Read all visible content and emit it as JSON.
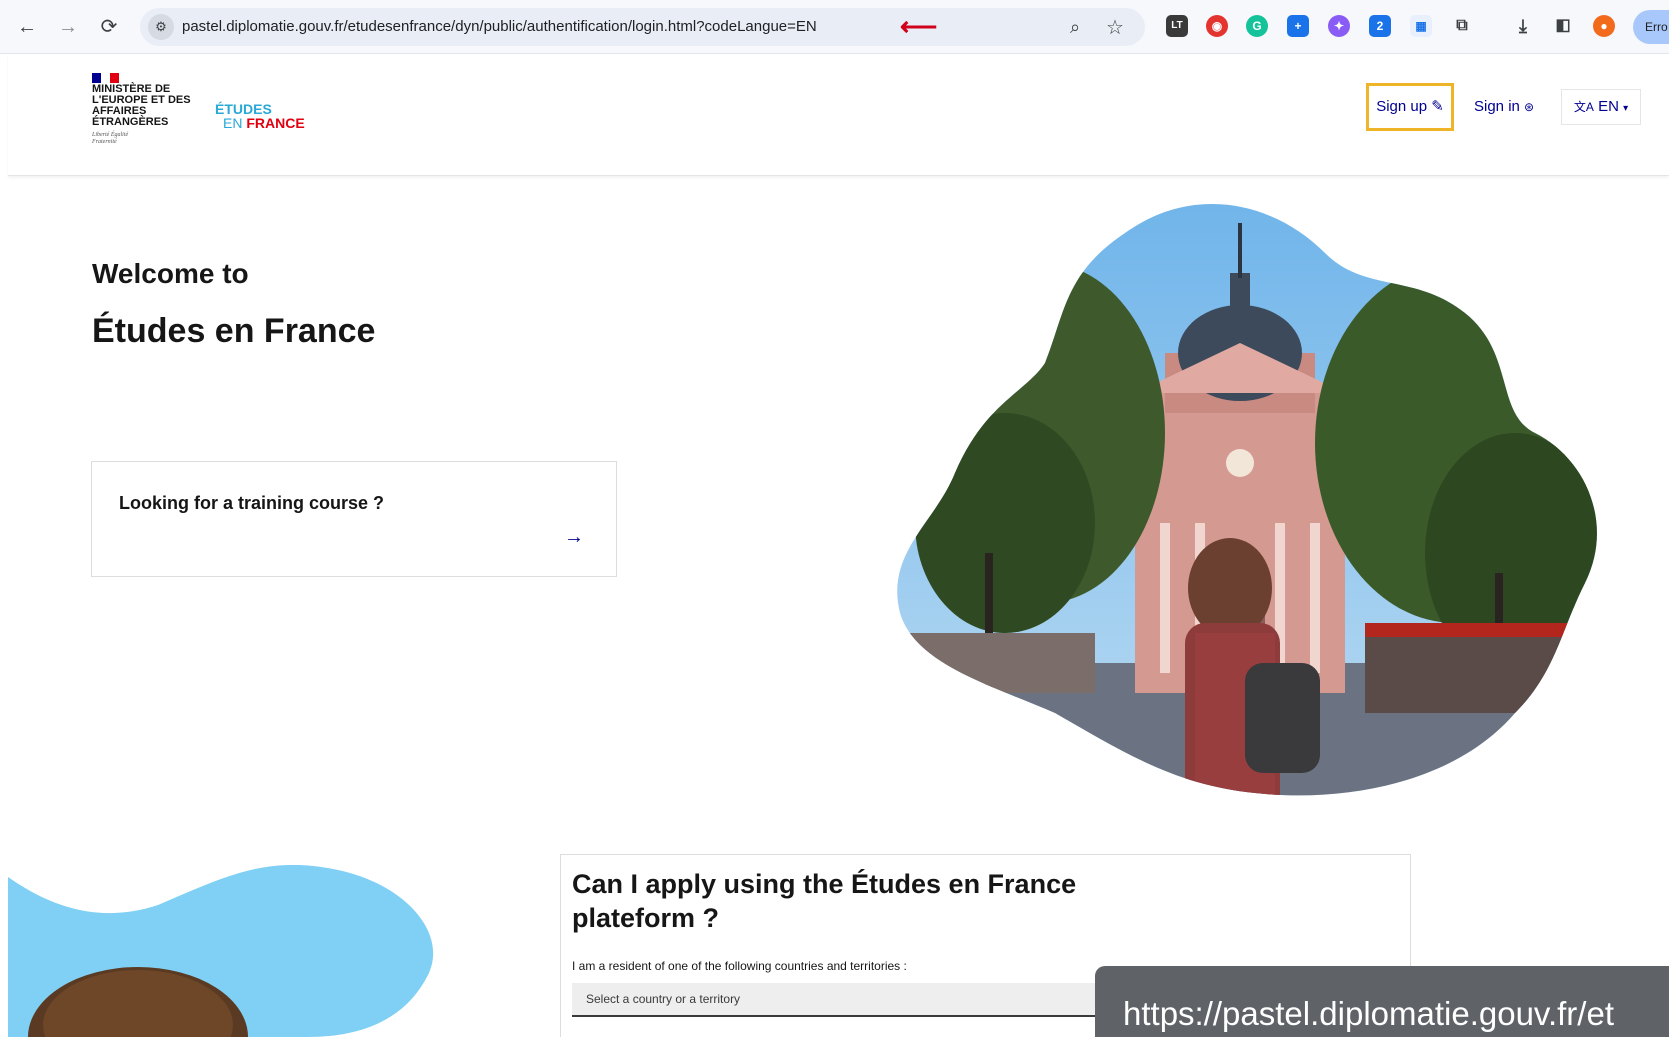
{
  "browser": {
    "back_icon": "arrow-left-icon",
    "forward_icon": "arrow-right-icon",
    "reload_icon": "reload-icon",
    "address": "pastel.diplomatie.gouv.fr/etudesenfrance/dyn/public/authentification/login.html?codeLangue=EN",
    "annotation_color": "#d0021b",
    "profile_label": "Erro",
    "extensions": [
      {
        "name": "languagetool",
        "glyph": "LT",
        "color": "#3a3a3a"
      },
      {
        "name": "red-extension",
        "glyph": "◉",
        "color": "#e3342f"
      },
      {
        "name": "grammarly",
        "glyph": "G",
        "color": "#15c39a"
      },
      {
        "name": "blue-plus",
        "glyph": "+",
        "color": "#1a73e8"
      },
      {
        "name": "fox",
        "glyph": "✦",
        "color": "#8a5cf6"
      },
      {
        "name": "badge",
        "glyph": "2",
        "color": "#1a73e8"
      },
      {
        "name": "sheet",
        "glyph": "▦",
        "color": "#1a73e8"
      },
      {
        "name": "puzzle",
        "glyph": "⧉",
        "color": "#3c4043"
      }
    ]
  },
  "header": {
    "ministry": "MINISTÈRE DE L'EUROPE ET DES AFFAIRES ÉTRANGÈRES",
    "motto": "Liberté Égalité Fraternité",
    "logo_line1": "ÉTUDES",
    "logo_line2_en": "EN",
    "logo_line2_france": "FRANCE",
    "signup": "Sign up",
    "signin": "Sign in",
    "language": "EN",
    "highlight_color": "#f0b429",
    "brand_blue": "#000091"
  },
  "main": {
    "welcome": "Welcome to",
    "title": "Études en France",
    "card_title": "Looking for a training course ?",
    "card_arrow_icon": "arrow-right-icon"
  },
  "faq": {
    "title": "Can I apply using the Études en France plateform ?",
    "resident_label": "I am a resident of one of the following countries and territories :",
    "select_placeholder": "Select a country or a territory"
  },
  "status_url": "https://pastel.diplomatie.gouv.fr/et"
}
